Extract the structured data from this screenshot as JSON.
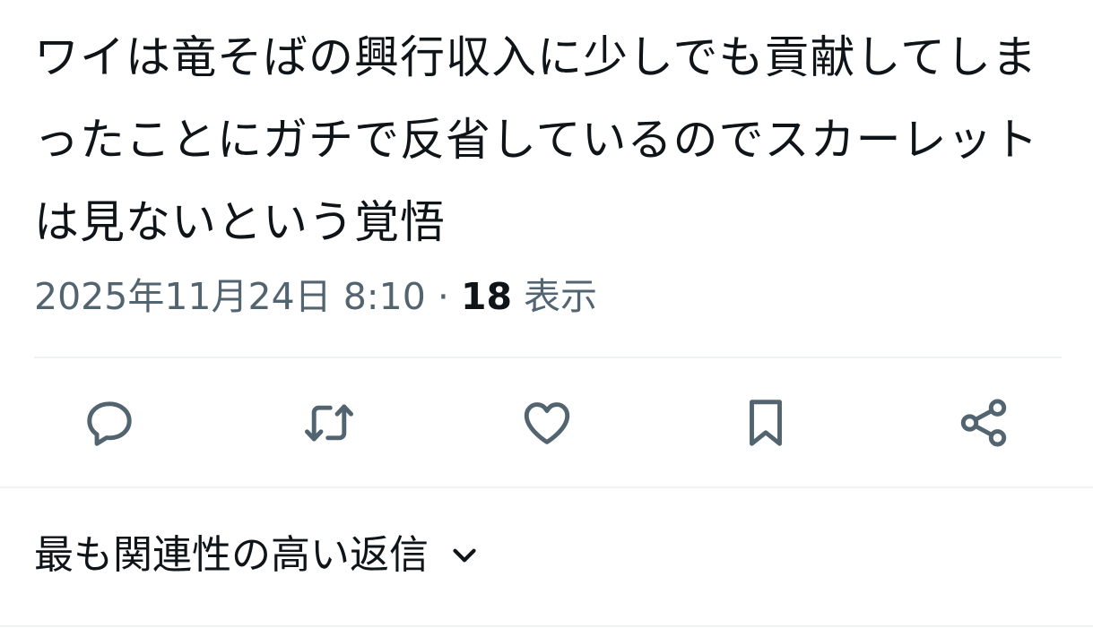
{
  "tweet": {
    "text": "ワイは竜そばの興行収入に少しでも貢献してしまったことにガチで反省しているのでスカーレットは見ないという覚悟",
    "timestamp": "2025年11月24日 8:10",
    "separator": "·",
    "views_count": "18",
    "views_label": "表示"
  },
  "actions": [
    {
      "name": "reply",
      "icon": "speech-bubble-icon"
    },
    {
      "name": "retweet",
      "icon": "retweet-icon"
    },
    {
      "name": "like",
      "icon": "heart-icon"
    },
    {
      "name": "bookmark",
      "icon": "bookmark-icon"
    },
    {
      "name": "share",
      "icon": "share-icon"
    }
  ],
  "replies_sort": {
    "label": "最も関連性の高い返信",
    "icon": "chevron-down-icon"
  },
  "colors": {
    "text_primary": "#0f1419",
    "text_secondary": "#536471",
    "divider": "#eff3f4",
    "icon": "#536471"
  }
}
